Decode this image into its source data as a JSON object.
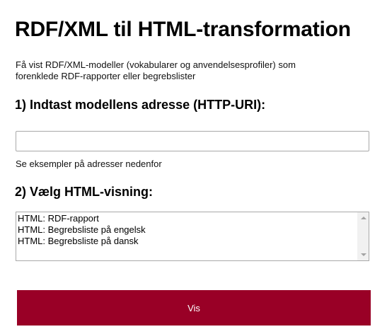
{
  "header": {
    "title": "RDF/XML til HTML-transformation"
  },
  "intro": {
    "text": "Få vist RDF/XML-modeller (vokabularer og anvendelsesprofiler) som forenklede RDF-rapporter eller begrebslister"
  },
  "step1": {
    "heading": "1) Indtast modellens adresse (HTTP-URI):",
    "input_value": "",
    "hint": "Se eksempler på adresser nedenfor"
  },
  "step2": {
    "heading": "2) Vælg HTML-visning:",
    "options": [
      "HTML: RDF-rapport",
      "HTML: Begrebsliste på engelsk",
      "HTML: Begrebsliste på dansk"
    ]
  },
  "submit": {
    "label": "Vis"
  },
  "colors": {
    "accent": "#990026"
  },
  "icons": {
    "scroll_up": "scroll-up-arrow-icon",
    "scroll_down": "scroll-down-arrow-icon"
  }
}
